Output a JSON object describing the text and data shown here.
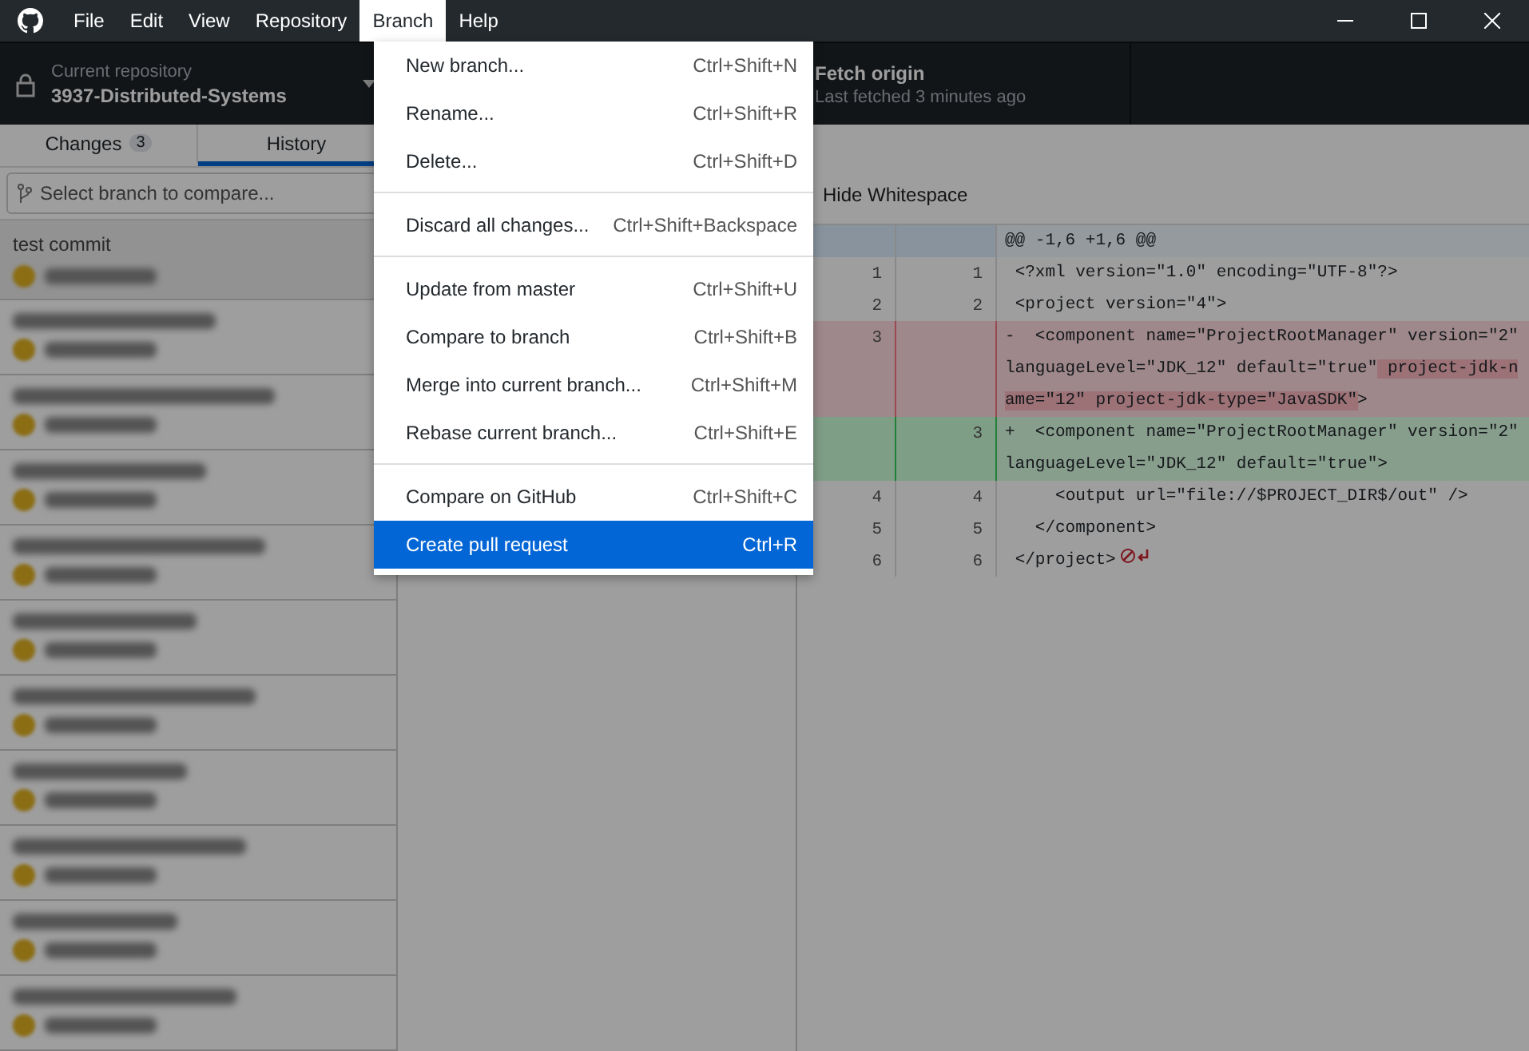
{
  "menubar": [
    {
      "label": "File",
      "selected": false
    },
    {
      "label": "Edit",
      "selected": false
    },
    {
      "label": "View",
      "selected": false
    },
    {
      "label": "Repository",
      "selected": false
    },
    {
      "label": "Branch",
      "selected": true
    },
    {
      "label": "Help",
      "selected": false
    }
  ],
  "toolbar": {
    "repository": {
      "caption": "Current repository",
      "name": "3937-Distributed-Systems"
    },
    "fetch": {
      "title": "Fetch origin",
      "subtitle": "Last fetched 3 minutes ago"
    }
  },
  "tabs": [
    {
      "label": "Changes",
      "count": "3",
      "selected": false
    },
    {
      "label": "History",
      "selected": true
    }
  ],
  "branch_filter": {
    "placeholder": "Select branch to compare..."
  },
  "commits": [
    {
      "title": "test commit",
      "selected": true
    },
    {
      "selected": false
    },
    {
      "selected": false
    },
    {
      "selected": false
    },
    {
      "selected": false
    },
    {
      "selected": false
    },
    {
      "selected": false
    },
    {
      "selected": false
    },
    {
      "selected": false
    },
    {
      "selected": false
    },
    {
      "selected": false
    }
  ],
  "diff": {
    "option": "Hide Whitespace",
    "lines": [
      {
        "kind": "hunk",
        "parts": [
          {
            "text": "@@ -1,6 +1,6 @@",
            "changed": false
          }
        ]
      },
      {
        "kind": "context",
        "old": "1",
        "new": "1",
        "parts": [
          {
            "text": " <?xml version=\"1.0\" encoding=\"UTF-8\"?>",
            "changed": false
          }
        ]
      },
      {
        "kind": "context",
        "old": "2",
        "new": "2",
        "parts": [
          {
            "text": " <project version=\"4\">",
            "changed": false
          }
        ]
      },
      {
        "kind": "deleted",
        "old": "3",
        "parts": [
          {
            "text": "-  <component name=\"ProjectRootManager\" version=\"2\" languageLevel=\"JDK_12\" default=\"true\"",
            "changed": false
          },
          {
            "text": " project-jdk-name=\"12\" project-jdk-type=\"JavaSDK\"",
            "changed": true
          },
          {
            "text": ">",
            "changed": false
          }
        ]
      },
      {
        "kind": "added",
        "new": "3",
        "parts": [
          {
            "text": "+  <component name=\"ProjectRootManager\" version=\"2\" languageLevel=\"JDK_12\" default=\"true\">",
            "changed": false
          }
        ]
      },
      {
        "kind": "context",
        "old": "4",
        "new": "4",
        "parts": [
          {
            "text": "     <output url=\"file://$PROJECT_DIR$/out\" />",
            "changed": false
          }
        ]
      },
      {
        "kind": "context",
        "old": "5",
        "new": "5",
        "parts": [
          {
            "text": "   </component>",
            "changed": false
          }
        ]
      },
      {
        "kind": "context",
        "old": "6",
        "new": "6",
        "no_newline": true,
        "parts": [
          {
            "text": " </project>",
            "changed": false
          }
        ]
      }
    ]
  },
  "branch_menu": {
    "groups": [
      [
        {
          "label": "New branch...",
          "shortcut": "Ctrl+Shift+N",
          "selected": false
        },
        {
          "label": "Rename...",
          "shortcut": "Ctrl+Shift+R",
          "selected": false
        },
        {
          "label": "Delete...",
          "shortcut": "Ctrl+Shift+D",
          "selected": false
        }
      ],
      [
        {
          "label": "Discard all changes...",
          "shortcut": "Ctrl+Shift+Backspace",
          "selected": false
        }
      ],
      [
        {
          "label": "Update from master",
          "shortcut": "Ctrl+Shift+U",
          "selected": false
        },
        {
          "label": "Compare to branch",
          "shortcut": "Ctrl+Shift+B",
          "selected": false
        },
        {
          "label": "Merge into current branch...",
          "shortcut": "Ctrl+Shift+M",
          "selected": false
        },
        {
          "label": "Rebase current branch...",
          "shortcut": "Ctrl+Shift+E",
          "selected": false
        }
      ],
      [
        {
          "label": "Compare on GitHub",
          "shortcut": "Ctrl+Shift+C",
          "selected": false
        },
        {
          "label": "Create pull request",
          "shortcut": "Ctrl+R",
          "selected": true
        }
      ]
    ]
  }
}
